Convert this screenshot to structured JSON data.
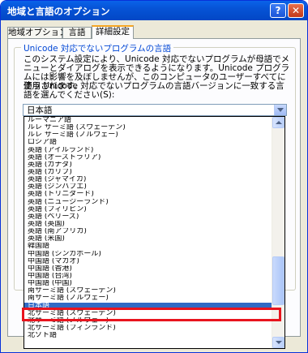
{
  "window": {
    "title": "地域と言語のオプション",
    "help_glyph": "?",
    "close_glyph": "✕"
  },
  "tabs": [
    {
      "label": "地域オプション"
    },
    {
      "label": "言語"
    },
    {
      "label": "詳細設定"
    }
  ],
  "group": {
    "title": "Unicode 対応でないプログラムの言語",
    "description": "このシステム設定により、Unicode 対応でないプログラムが母語でメニューとダイアログを表示できるようになります。Unicode プログラムには影響を及ぼしませんが、このコンピュータのユーザーすべてに適用されます。",
    "prompt": "使う Unicode 対応でないプログラムの言語バージョンに一致する言語を選んでください(S):"
  },
  "combo": {
    "value": "日本語"
  },
  "dropdown": {
    "items": [
      "ルーマニア語",
      "ルレ サーミ語 (スウェーデン)",
      "ルレ サーミ語 (ノルウェー)",
      "ロシア語",
      "英語 (アイルランド)",
      "英語 (オーストラリア)",
      "英語 (カナダ)",
      "英語 (カリブ)",
      "英語 (ジャマイカ)",
      "英語 (ジンバブエ)",
      "英語 (トリニダード)",
      "英語 (ニュージーランド)",
      "英語 (フィリピン)",
      "英語 (ベリーズ)",
      "英語 (英国)",
      "英語 (南アフリカ)",
      "英語 (米国)",
      "韓国語",
      "中国語 (シンガポール)",
      "中国語 (マカオ)",
      "中国語 (香港)",
      "中国語 (台湾)",
      "中国語 (中国)",
      "南サーミ語 (スウェーデン)",
      "南サーミ語 (ノルウェー)",
      "日本語",
      "北サーミ語 (スウェーデン)",
      "北サーミ語 (ノルウェー)",
      "北サーミ語 (フィンランド)",
      "北ソト語"
    ],
    "selected_index": 25,
    "scroll_position": 0.8
  },
  "colors": {
    "titlebar": "#0653d6",
    "selection": "#316ac5",
    "highlight_box": "#e8141e",
    "group_title": "#0046d5"
  }
}
